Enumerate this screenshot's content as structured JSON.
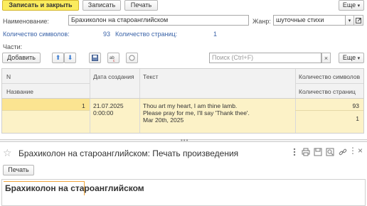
{
  "toolbar": {
    "save_close": "Записать и закрыть",
    "save": "Записать",
    "print": "Печать",
    "more": "Еще"
  },
  "form": {
    "name_label": "Наименование:",
    "name_value": "Брахиколон на староанглийском",
    "genre_label": "Жанр:",
    "genre_value": "шуточные стихи",
    "chars_label": "Количество символов:",
    "chars_value": "93",
    "pages_label": "Количество страниц:",
    "pages_value": "1",
    "parts_label": "Части:"
  },
  "parts_toolbar": {
    "add": "Добавить",
    "search_placeholder": "Поиск (Ctrl+F)",
    "clear": "×",
    "more": "Еще"
  },
  "table": {
    "headers": {
      "n": "N",
      "name": "Название",
      "date": "Дата создания",
      "text": "Текст",
      "chars": "Количество символов",
      "pages": "Количество страниц"
    },
    "rows": [
      {
        "n": "1",
        "date": "21.07.2025",
        "time": "0:00:00",
        "text_line1": "Thou art my heart, I am thine lamb.",
        "text_line2": "Please pray for me, I'll say 'Thank thee'.",
        "text_line3": "Mar 20th, 2025",
        "chars": "93",
        "pages": "1"
      }
    ]
  },
  "print_window": {
    "title": "Брахиколон на староанглийском: Печать произведения",
    "print_button": "Печать",
    "document_heading": "Брахиколон на староанглийском"
  },
  "colors": {
    "primary_button": "#fbec5d",
    "selected_row": "#fcf2c7",
    "link_blue": "#3a63a8"
  }
}
